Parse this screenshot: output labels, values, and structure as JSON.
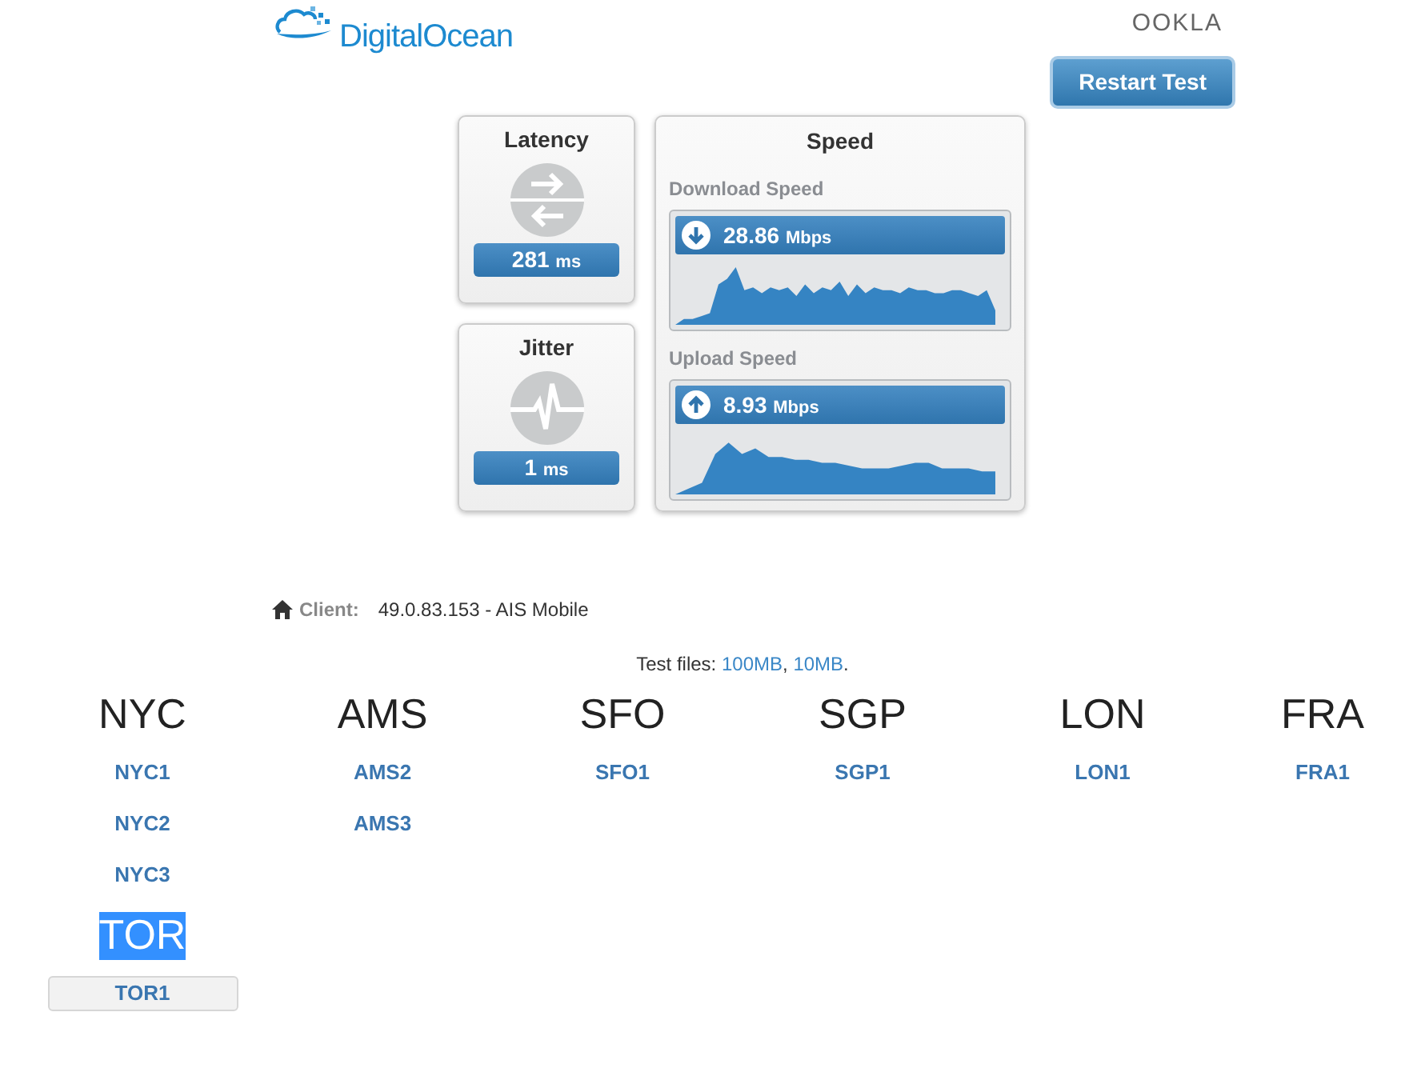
{
  "header": {
    "logo": "DigitalOcean",
    "ookla": "OOKLA",
    "restart_button": "Restart Test"
  },
  "latency": {
    "title": "Latency",
    "value": "281",
    "unit": "ms"
  },
  "jitter": {
    "title": "Jitter",
    "value": "1",
    "unit": "ms"
  },
  "speed": {
    "title": "Speed",
    "tests": [
      {
        "kind": "download",
        "label": "Download Speed",
        "value": "28.86",
        "unit": "Mbps"
      },
      {
        "kind": "upload",
        "label": "Upload Speed",
        "value": "8.93",
        "unit": "Mbps"
      }
    ]
  },
  "client": {
    "label": "Client:",
    "value": "49.0.83.153 - AIS Mobile"
  },
  "test_files": {
    "label": "Test files:",
    "links": [
      "100MB",
      "10MB"
    ],
    "separator": ",",
    "end": "."
  },
  "regions": [
    {
      "name": "NYC",
      "selected": false,
      "servers": [
        {
          "name": "NYC1",
          "selected": false
        },
        {
          "name": "NYC2",
          "selected": false
        },
        {
          "name": "NYC3",
          "selected": false
        }
      ]
    },
    {
      "name": "AMS",
      "selected": false,
      "servers": [
        {
          "name": "AMS2",
          "selected": false
        },
        {
          "name": "AMS3",
          "selected": false
        }
      ]
    },
    {
      "name": "SFO",
      "selected": false,
      "servers": [
        {
          "name": "SFO1",
          "selected": false
        }
      ]
    },
    {
      "name": "SGP",
      "selected": false,
      "servers": [
        {
          "name": "SGP1",
          "selected": false
        }
      ]
    },
    {
      "name": "LON",
      "selected": false,
      "servers": [
        {
          "name": "LON1",
          "selected": false
        }
      ]
    },
    {
      "name": "FRA",
      "selected": false,
      "servers": [
        {
          "name": "FRA1",
          "selected": false
        }
      ]
    },
    {
      "name": "TOR",
      "selected": true,
      "servers": [
        {
          "name": "TOR1",
          "selected": true
        }
      ]
    }
  ]
}
